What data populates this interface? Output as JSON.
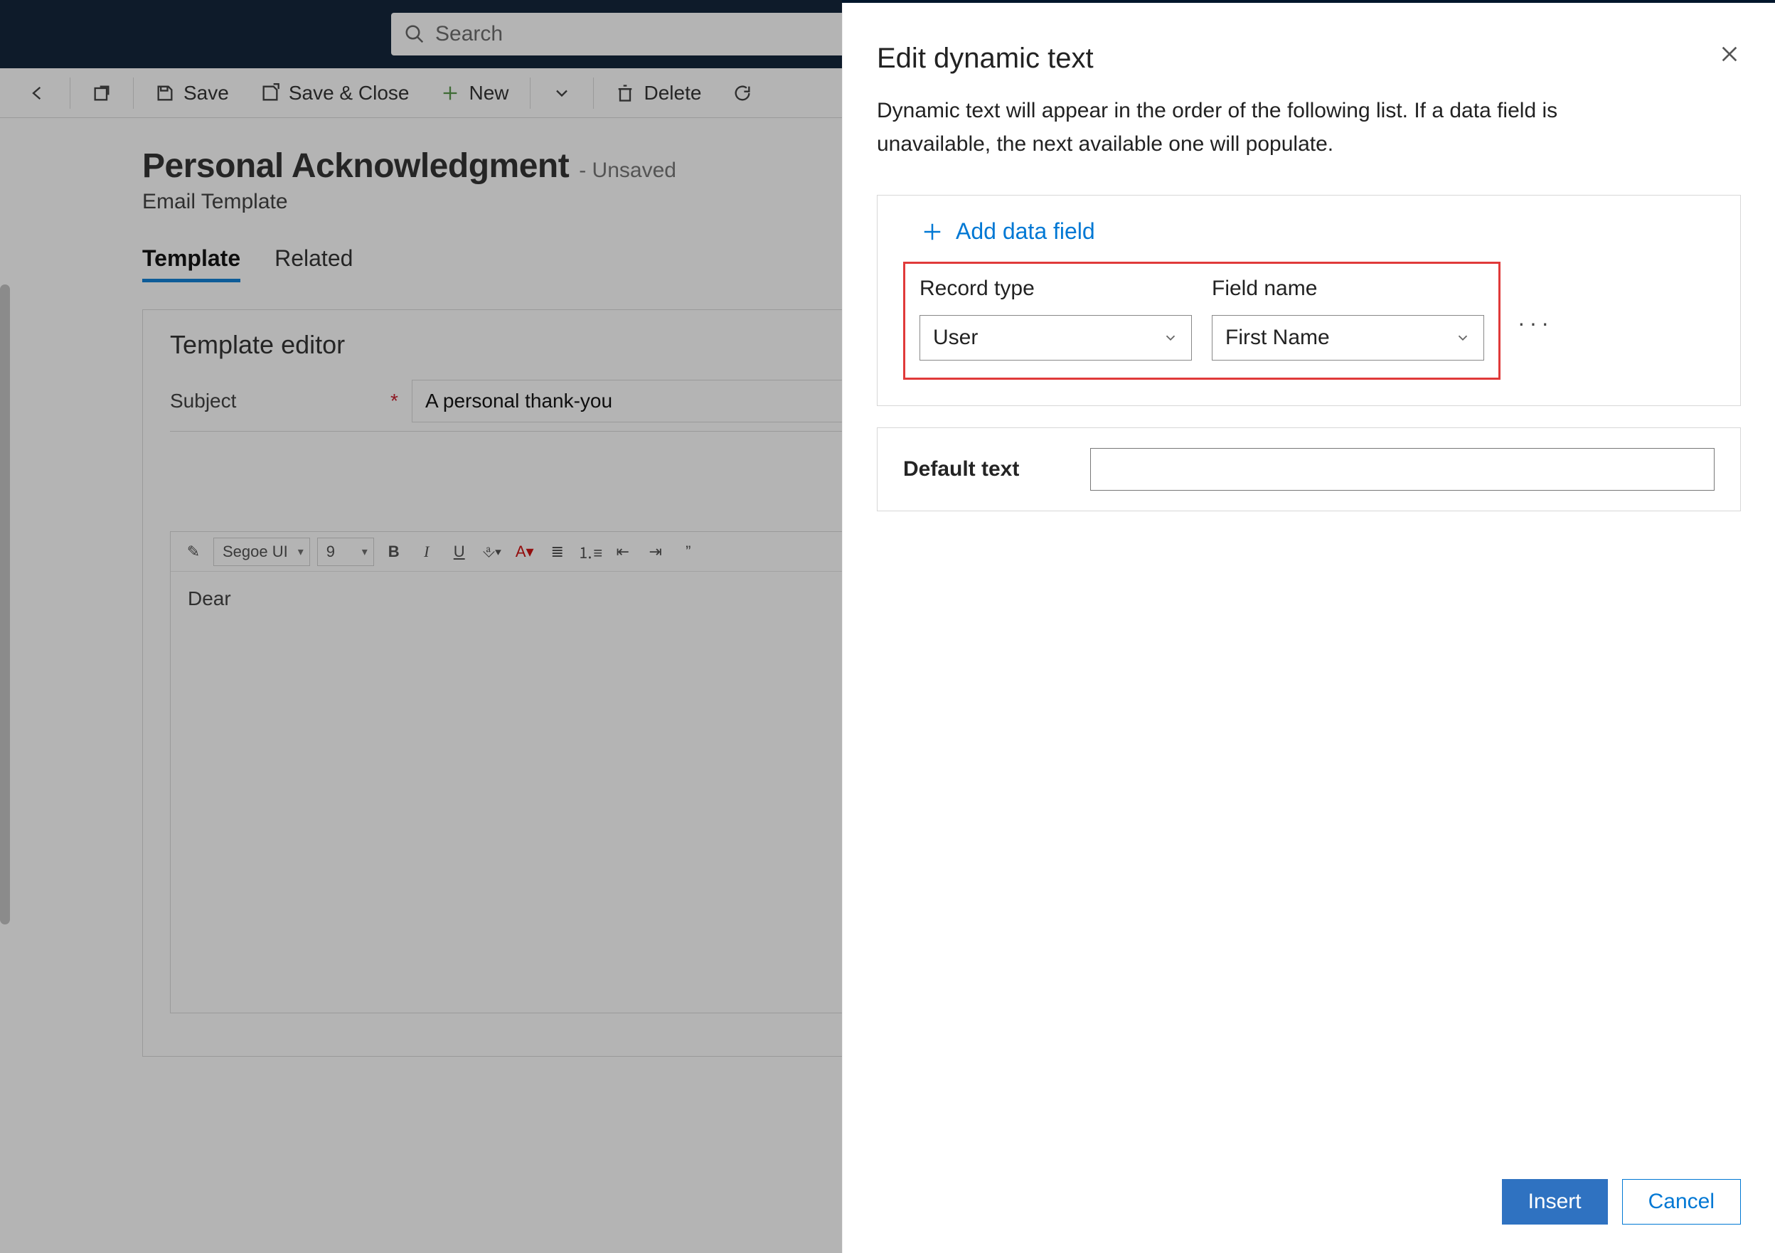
{
  "search": {
    "placeholder": "Search"
  },
  "commands": {
    "save": "Save",
    "save_close": "Save & Close",
    "new": "New",
    "delete": "Delete"
  },
  "page": {
    "title": "Personal Acknowledgment",
    "status_suffix": "- Unsaved",
    "subtype": "Email Template"
  },
  "tabs": {
    "template": "Template",
    "related": "Related"
  },
  "editor": {
    "heading": "Template editor",
    "subject_label": "Subject",
    "subject_value": "A personal thank-you",
    "font_name": "Segoe UI",
    "font_size": "9",
    "body": "Dear"
  },
  "panel": {
    "title": "Edit dynamic text",
    "description": "Dynamic text will appear in the order of the following list. If a data field is unavailable, the next available one will populate.",
    "add_field": "Add data field",
    "record_type_label": "Record type",
    "record_type_value": "User",
    "field_name_label": "Field name",
    "field_name_value": "First Name",
    "default_text_label": "Default text",
    "default_text_value": "",
    "insert": "Insert",
    "cancel": "Cancel"
  }
}
